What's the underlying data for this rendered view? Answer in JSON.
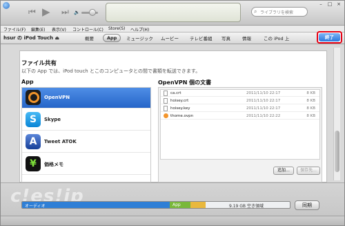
{
  "window": {
    "apple_logo": "",
    "min_glyph": "–",
    "max_glyph": "□",
    "close_glyph": "×"
  },
  "player": {
    "prev_glyph": "⏮",
    "play_glyph": "▶",
    "next_glyph": "⏭",
    "volume_glyph": "🔈",
    "search_placeholder": "ライブラリを検索",
    "search_glyph": "⌕"
  },
  "menubar": {
    "items": [
      "ファイル(F)",
      "編集(E)",
      "表示(V)",
      "コントロール(C)",
      "Store(S)",
      "ヘルプ(H)"
    ]
  },
  "device_bar": {
    "device_name": "hsur の iPod Touch ⏏",
    "tabs": [
      "概要",
      "App",
      "ミュージック",
      "ムービー",
      "テレビ番組",
      "写真",
      "情報",
      "この iPod 上"
    ],
    "active_tab": "App",
    "done_label": "終了"
  },
  "file_sharing": {
    "title": "ファイル共有",
    "description": "以下の App では、iPod touch とこのコンピュータとの間で書類を転送できます。",
    "apps_heading": "App",
    "apps": [
      {
        "name": "OpenVPN",
        "icon": "openvpn-icon",
        "glyph": "",
        "selected": true
      },
      {
        "name": "Skype",
        "icon": "skype-icon",
        "glyph": "S",
        "selected": false
      },
      {
        "name": "Tweet ATOK",
        "icon": "atok-icon",
        "glyph": "A",
        "selected": false
      },
      {
        "name": "価格メモ",
        "icon": "price-memo-icon",
        "glyph": "¥",
        "selected": false
      }
    ],
    "docs_heading": "OpenVPN 個の文書",
    "documents": [
      {
        "name": "ca.crt",
        "date": "2011/11/10 22:17",
        "size": "8 KB",
        "icon": "file-icon"
      },
      {
        "name": "hoisey.crt",
        "date": "2011/11/10 22:17",
        "size": "8 KB",
        "icon": "file-icon"
      },
      {
        "name": "hoisey.key",
        "date": "2011/11/10 22:17",
        "size": "8 KB",
        "icon": "file-icon"
      },
      {
        "name": "thome.ovpn",
        "date": "2011/11/10 22:22",
        "size": "8 KB",
        "icon": "openvpn-file-icon"
      }
    ],
    "add_button": "追加...",
    "save_button": "保存先..."
  },
  "capacity": {
    "audio_label": "オーディオ",
    "app_label": "App",
    "free_label": "9.19 GB 空き領域",
    "audio_color": "#2f7fd6",
    "app_color": "#79b83a",
    "other_color": "#e9b83d",
    "sync_button": "同期"
  },
  "watermark": "c!es!jp"
}
